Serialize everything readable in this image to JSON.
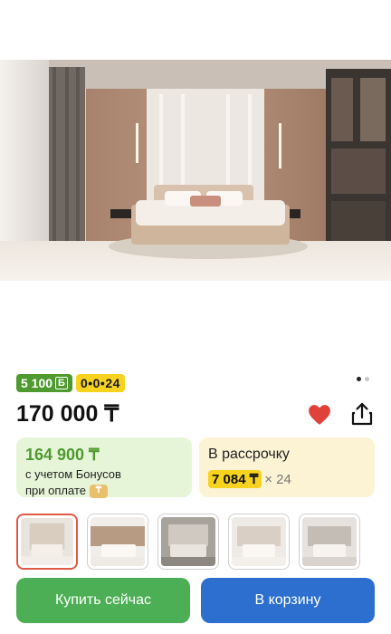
{
  "product": {
    "image_icon": "bedroom-photo",
    "gallery_dots": {
      "count": 2,
      "active_index": 0
    },
    "bonus_badge": "5 100",
    "bonus_badge_icon": "bonus-b-icon",
    "installment_badge": "0•0•24",
    "price": "170 000 ₸",
    "favorite_icon": "heart-filled-icon",
    "share_icon": "share-icon",
    "bonus_card": {
      "price": "164 900 ₸",
      "note_line1": "с учетом Бонусов",
      "note_line2": "при оплате",
      "coin_icon": "kaspi-coin-icon"
    },
    "installment_card": {
      "title": "В рассрочку",
      "amount": "7 084 ₸",
      "months": "× 24"
    },
    "thumbnails": [
      {
        "name": "thumb-1",
        "selected": true
      },
      {
        "name": "thumb-2",
        "selected": false
      },
      {
        "name": "thumb-3",
        "selected": false
      },
      {
        "name": "thumb-4",
        "selected": false
      },
      {
        "name": "thumb-5",
        "selected": false
      }
    ]
  },
  "actions": {
    "buy_now": "Купить сейчас",
    "add_to_cart": "В корзину"
  },
  "colors": {
    "bonus_green": "#4e9a2e",
    "installment_yellow": "#f7d320",
    "buy_button": "#4cae55",
    "cart_button": "#2c6fcf",
    "heart_red": "#e0413a"
  }
}
